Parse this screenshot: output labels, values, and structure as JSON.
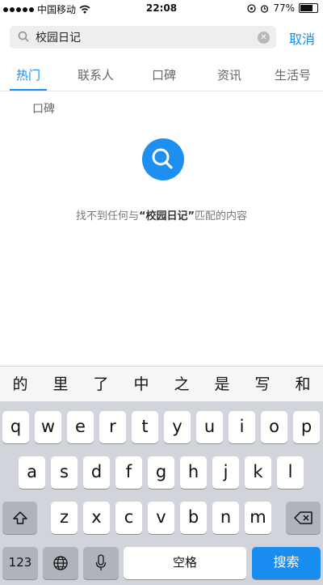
{
  "status": {
    "carrier": "中国移动",
    "time": "22:08",
    "battery": "77%",
    "battery_level": 0.77
  },
  "search": {
    "value": "校园日记",
    "cancel_label": "取消"
  },
  "tabs": [
    {
      "label": "热门"
    },
    {
      "label": "联系人"
    },
    {
      "label": "口碑"
    },
    {
      "label": "资讯"
    },
    {
      "label": "生活号"
    }
  ],
  "section_label": "口碑",
  "empty_message": {
    "prefix": "找不到任何与",
    "query": "“校园日记”",
    "suffix": "匹配的内容"
  },
  "candidates": [
    "的",
    "里",
    "了",
    "中",
    "之",
    "是",
    "写",
    "和"
  ],
  "keyboard": {
    "row1": [
      "q",
      "w",
      "e",
      "r",
      "t",
      "y",
      "u",
      "i",
      "o",
      "p"
    ],
    "row2": [
      "a",
      "s",
      "d",
      "f",
      "g",
      "h",
      "j",
      "k",
      "l"
    ],
    "row3": [
      "z",
      "x",
      "c",
      "v",
      "b",
      "n",
      "m"
    ],
    "numbers_label": "123",
    "space_label": "空格",
    "search_label": "搜索"
  },
  "colors": {
    "accent": "#1a8ef0",
    "keyboard_bg": "#d1d4da"
  }
}
